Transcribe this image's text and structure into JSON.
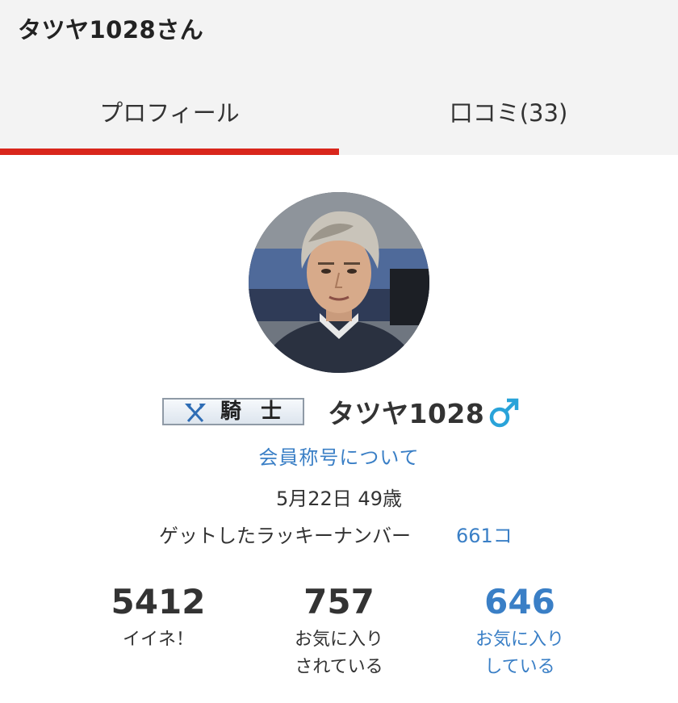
{
  "header": {
    "title": "タツヤ1028さん"
  },
  "tabs": [
    {
      "label": "プロフィール",
      "active": true
    },
    {
      "label": "口コミ(33)",
      "active": false
    }
  ],
  "colors": {
    "accent_red": "#d9261c",
    "link_blue": "#3a7fc6",
    "topbar_bg": "#f3f3f3"
  },
  "profile": {
    "rank_badge_label": "騎士",
    "rank_badge_icon": "crossed-axes-icon",
    "username": "タツヤ1028",
    "gender_icon": "male-symbol-icon",
    "title_link": "会員称号について",
    "birthday": "5月22日 49歳",
    "lucky_number_label": "ゲットしたラッキーナンバー",
    "lucky_number_value": "661コ"
  },
  "stats": {
    "likes": {
      "value": "5412",
      "label": "イイネ！"
    },
    "favorited": {
      "value": "757",
      "label_line1": "お気に入り",
      "label_line2": "されている"
    },
    "favoriting": {
      "value": "646",
      "label_line1": "お気に入り",
      "label_line2": "している"
    }
  }
}
